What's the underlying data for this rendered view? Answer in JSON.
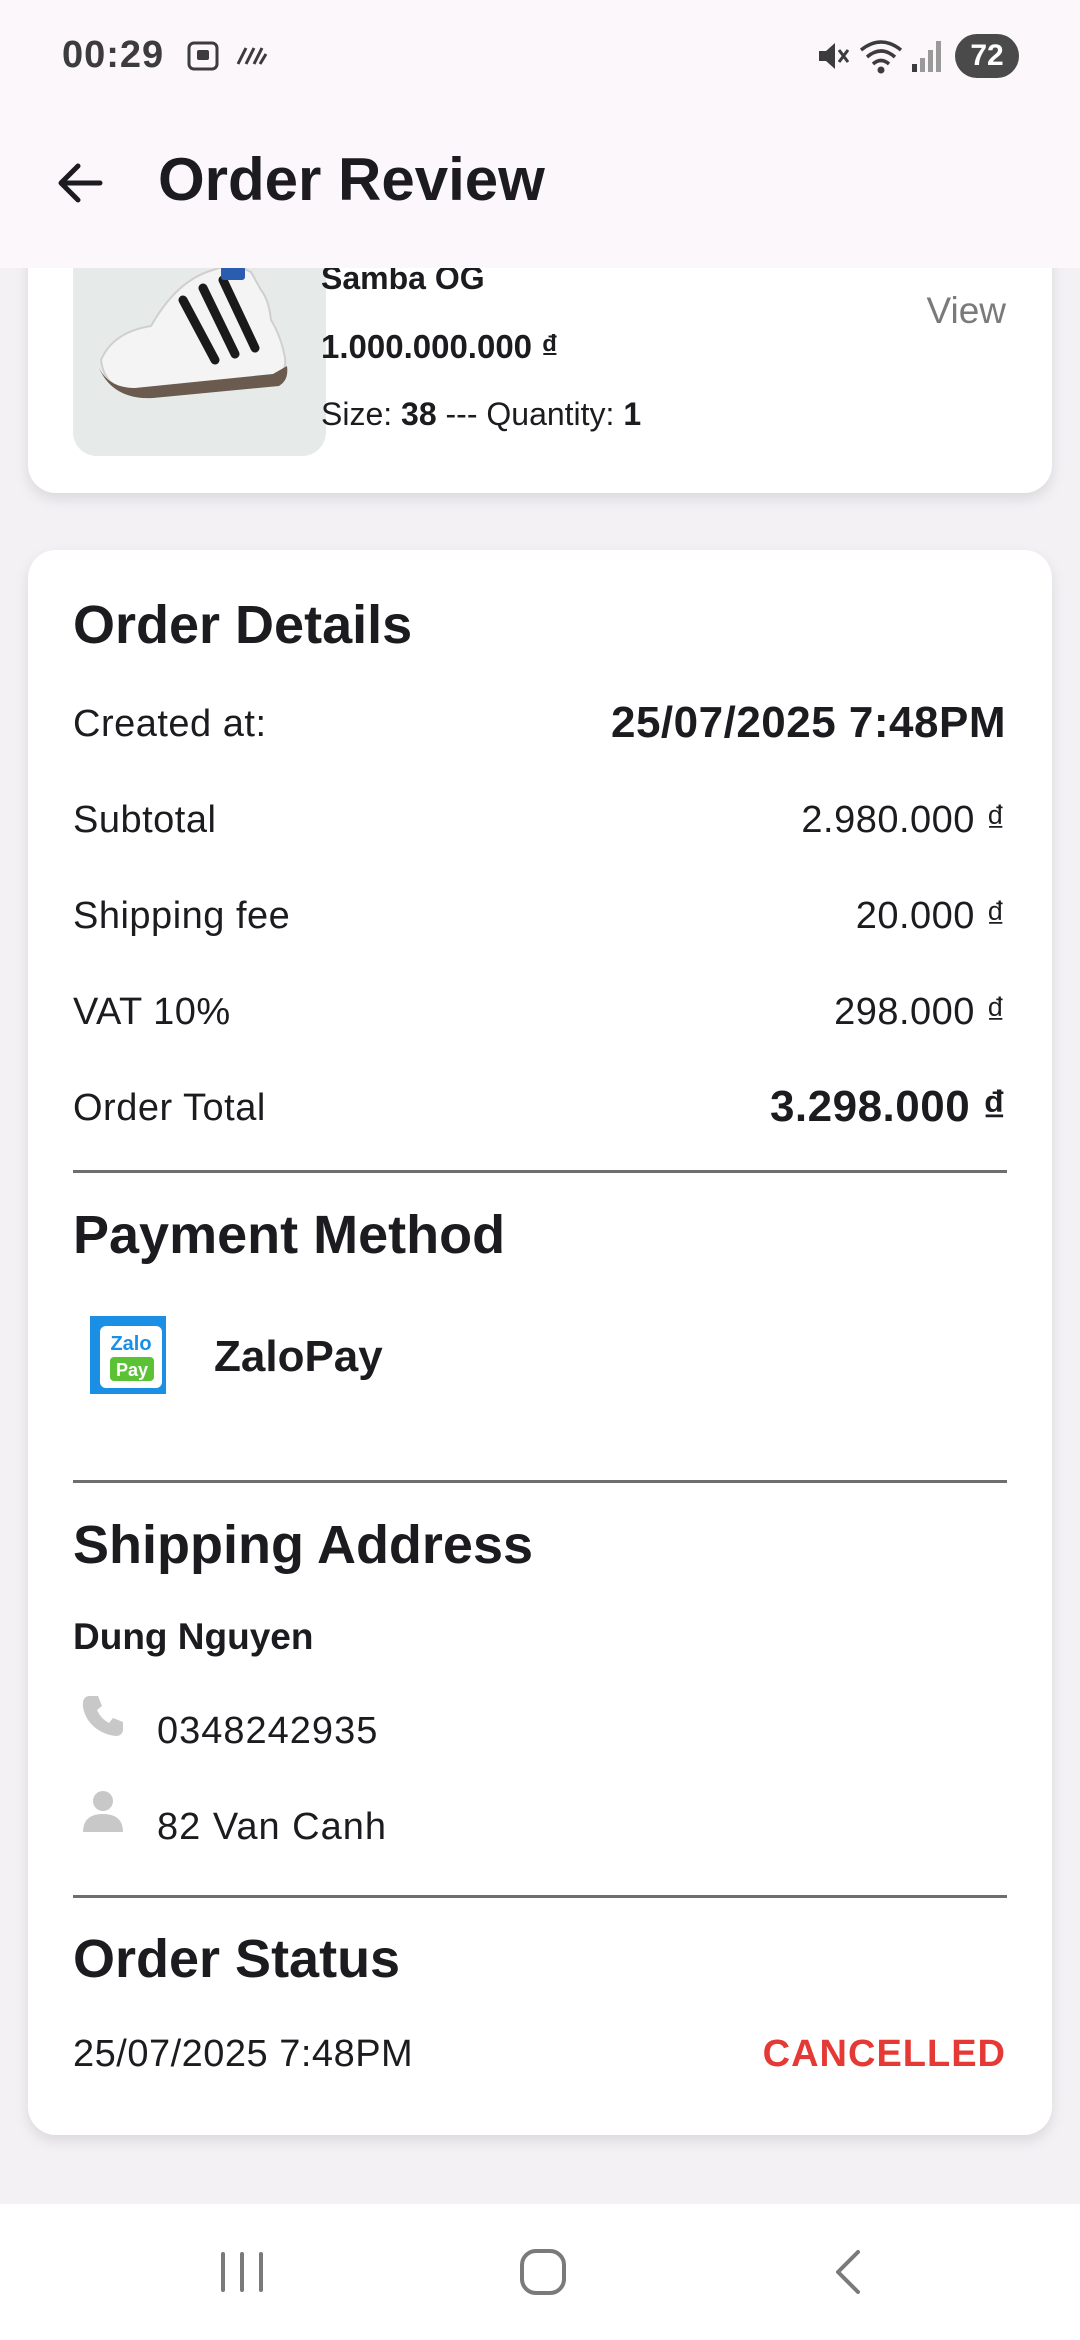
{
  "status_bar": {
    "time": "00:29",
    "battery": "72",
    "icons": [
      "screenshot-icon",
      "nfc-icon",
      "mute-icon",
      "wifi-icon",
      "signal-icon"
    ]
  },
  "app_bar": {
    "title": "Order Review",
    "back_icon": "arrow-left-icon"
  },
  "product": {
    "name": "Samba OG",
    "price": "1.000.000.000 ₫",
    "size_label": "Size: ",
    "size_value": "38",
    "separator": " --- Quantity: ",
    "quantity_value": "1",
    "view_label": "View"
  },
  "order_details": {
    "title": "Order Details",
    "created_label": "Created at:",
    "created_value": "25/07/2025 7:48PM",
    "subtotal_label": "Subtotal",
    "subtotal_value": "2.980.000 ₫",
    "shipping_label": "Shipping fee",
    "shipping_value": "20.000 ₫",
    "vat_label": "VAT 10%",
    "vat_value": "298.000 ₫",
    "total_label": "Order Total",
    "total_value": "3.298.000 ₫"
  },
  "payment": {
    "title": "Payment Method",
    "method": "ZaloPay",
    "logo_text_top": "Zalo",
    "logo_text_bottom": "Pay"
  },
  "shipping": {
    "title": "Shipping Address",
    "name": "Dung Nguyen",
    "phone": "0348242935",
    "address": "82 Van Canh"
  },
  "status": {
    "title": "Order Status",
    "date": "25/07/2025 7:48PM",
    "value": "CANCELLED",
    "color": "#e53935"
  },
  "nav": [
    "recents-icon",
    "home-icon",
    "back-icon"
  ]
}
